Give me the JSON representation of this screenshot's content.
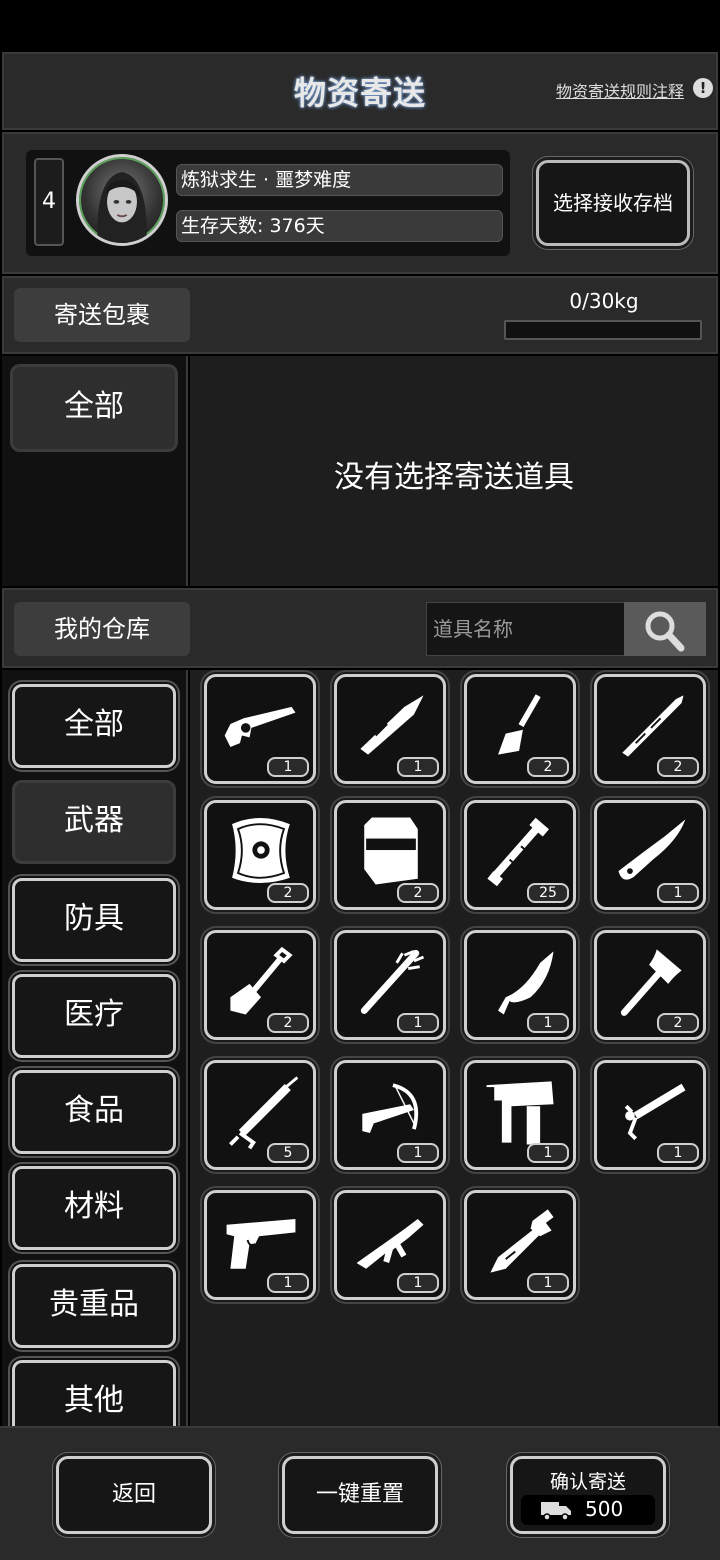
{
  "header": {
    "title": "物资寄送",
    "rules_link": "物资寄送规则注释",
    "info_icon": "!"
  },
  "save": {
    "level": "4",
    "name": "炼狱求生 · 噩梦难度",
    "days": "生存天数: 376天",
    "select_button": "选择接收存档"
  },
  "parcel": {
    "label": "寄送包裹",
    "weight_text": "0/30kg",
    "weight_fraction": 0,
    "category": "全部",
    "empty_message": "没有选择寄送道具"
  },
  "warehouse": {
    "label": "我的仓库",
    "search_placeholder": "道具名称",
    "categories": [
      "全部",
      "武器",
      "防具",
      "医疗",
      "食品",
      "材料",
      "贵重品",
      "其他"
    ],
    "active_category": 1,
    "items": [
      {
        "icon": "revolver-icon",
        "qty": "1"
      },
      {
        "icon": "spear-icon",
        "qty": "1"
      },
      {
        "icon": "trowel-icon",
        "qty": "2"
      },
      {
        "icon": "crowbar-icon",
        "qty": "2"
      },
      {
        "icon": "shield-icon",
        "qty": "2"
      },
      {
        "icon": "riot-shield-icon",
        "qty": "2"
      },
      {
        "icon": "pipe-icon",
        "qty": "25"
      },
      {
        "icon": "knife-icon",
        "qty": "1"
      },
      {
        "icon": "shovel-icon",
        "qty": "2"
      },
      {
        "icon": "spiked-bat-icon",
        "qty": "1"
      },
      {
        "icon": "machete-icon",
        "qty": "1"
      },
      {
        "icon": "axe-icon",
        "qty": "2"
      },
      {
        "icon": "caulk-gun-icon",
        "qty": "5"
      },
      {
        "icon": "crossbow-pistol-icon",
        "qty": "1"
      },
      {
        "icon": "nail-gun-icon",
        "qty": "1"
      },
      {
        "icon": "grease-gun-icon",
        "qty": "1"
      },
      {
        "icon": "pistol-icon",
        "qty": "1"
      },
      {
        "icon": "smg-icon",
        "qty": "1"
      },
      {
        "icon": "wrench-icon",
        "qty": "1"
      }
    ]
  },
  "footer": {
    "back": "返回",
    "reset": "一键重置",
    "confirm": "确认寄送",
    "cost": "500",
    "cost_icon": "truck-icon"
  }
}
